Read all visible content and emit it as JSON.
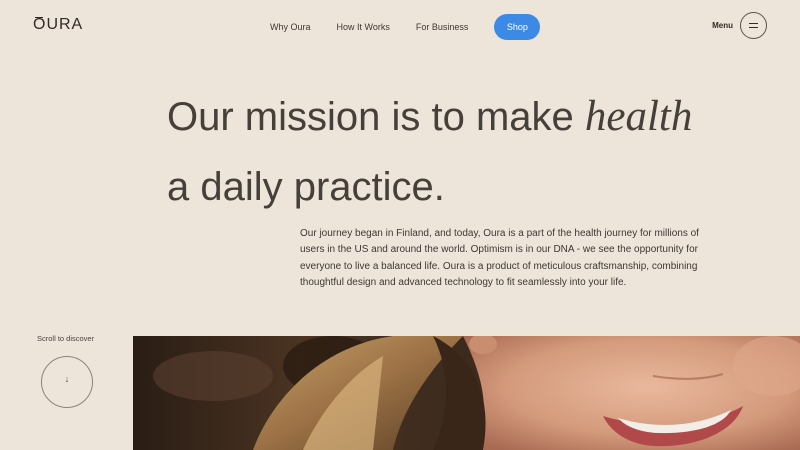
{
  "header": {
    "logo": "OURA",
    "nav": [
      {
        "label": "Why Oura"
      },
      {
        "label": "How It Works"
      },
      {
        "label": "For Business"
      }
    ],
    "shop_label": "Shop",
    "menu_label": "Menu"
  },
  "hero": {
    "headline_line1_start": "Our mission is to make ",
    "headline_line1_emphasis": "health",
    "headline_line2": "a daily practice.",
    "intro": "Our journey began in Finland, and today, Oura is a part of the health journey for millions of users in the US and around the world. Optimism is in our DNA - we see the opportunity for everyone to live a balanced life. Oura is a product of meticulous craftsmanship, combining thoughtful design and advanced technology to fit seamlessly into your life."
  },
  "scroll": {
    "label": "Scroll to discover",
    "icon": "arrow-down-icon"
  },
  "colors": {
    "background": "#ede5da",
    "accent": "#3c8ae6",
    "text": "#3d3833"
  }
}
